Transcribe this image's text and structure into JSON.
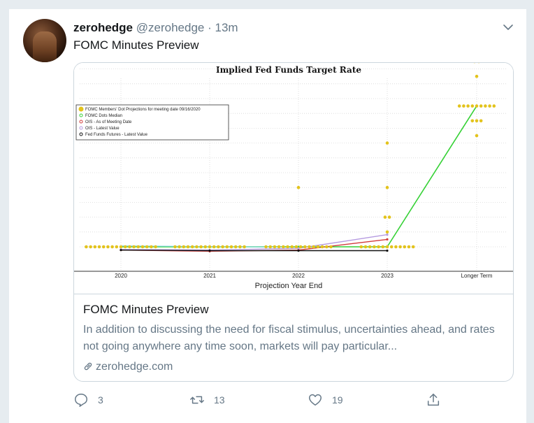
{
  "tweet": {
    "name": "zerohedge",
    "handle": "@zerohedge",
    "separator": "·",
    "time": "13m",
    "text": "FOMC Minutes Preview"
  },
  "card": {
    "title": "FOMC Minutes Preview",
    "description": "In addition to discussing the need for fiscal stimulus, uncertainties ahead, and rates not going anywhere any time soon, markets will pay particular...",
    "domain": "zerohedge.com"
  },
  "actions": {
    "reply_count": "3",
    "retweet_count": "13",
    "like_count": "19"
  },
  "icons": {
    "reply": "reply-icon",
    "retweet": "retweet-icon",
    "like": "heart-icon",
    "share": "share-icon",
    "link": "link-icon",
    "more": "chevron-down-icon"
  },
  "colors": {
    "dots": "#e3c31c",
    "median": "#35d135",
    "oisMeeting": "#d23b3b",
    "oisLatest": "#b59ae0",
    "futures": "#111111",
    "lightBlue": "#7fd3e0"
  },
  "chart_data": {
    "type": "scatter",
    "title": "Implied Fed Funds Target Rate",
    "xlabel": "Projection Year End",
    "ylabel": "",
    "categories": [
      "2020",
      "2021",
      "2022",
      "2023",
      "Longer Term"
    ],
    "legend_position": "top-left",
    "legend": [
      "FOMC Members' Dot Projections for meeting date 09/16/2020",
      "FOMC Dots Median",
      "OIS - As of Meeting Date",
      "OIS - Latest Value",
      "Fed Funds Futures - Latest Value"
    ],
    "dot_projections": [
      {
        "x": "2020",
        "y": 0.125,
        "count": 17
      },
      {
        "x": "2021",
        "y": 0.125,
        "count": 17
      },
      {
        "x": "2022",
        "y": 0.125,
        "count": 16
      },
      {
        "x": "2022",
        "y": 1.125,
        "count": 1
      },
      {
        "x": "2023",
        "y": 0.125,
        "count": 13
      },
      {
        "x": "2023",
        "y": 0.375,
        "count": 1
      },
      {
        "x": "2023",
        "y": 0.625,
        "count": 2
      },
      {
        "x": "2023",
        "y": 1.125,
        "count": 1
      },
      {
        "x": "2023",
        "y": 1.875,
        "count": 1
      },
      {
        "x": "Longer Term",
        "y": 2.0,
        "count": 1
      },
      {
        "x": "Longer Term",
        "y": 2.25,
        "count": 3
      },
      {
        "x": "Longer Term",
        "y": 2.5,
        "count": 9
      },
      {
        "x": "Longer Term",
        "y": 3.0,
        "count": 1
      },
      {
        "x": "Longer Term",
        "y": 3.25,
        "count": 2
      }
    ],
    "series": [
      {
        "name": "FOMC Dots Median",
        "values": [
          0.125,
          0.125,
          0.125,
          0.125,
          2.5
        ]
      },
      {
        "name": "OIS - As of Meeting Date",
        "values": [
          0.07,
          0.05,
          0.07,
          0.25
        ]
      },
      {
        "name": "OIS - Latest Value",
        "values": [
          0.08,
          0.07,
          0.1,
          0.33
        ]
      },
      {
        "name": "Fed Funds Futures - Latest Value",
        "values": [
          0.07,
          0.06,
          0.06,
          0.06
        ]
      }
    ],
    "grid": true
  }
}
